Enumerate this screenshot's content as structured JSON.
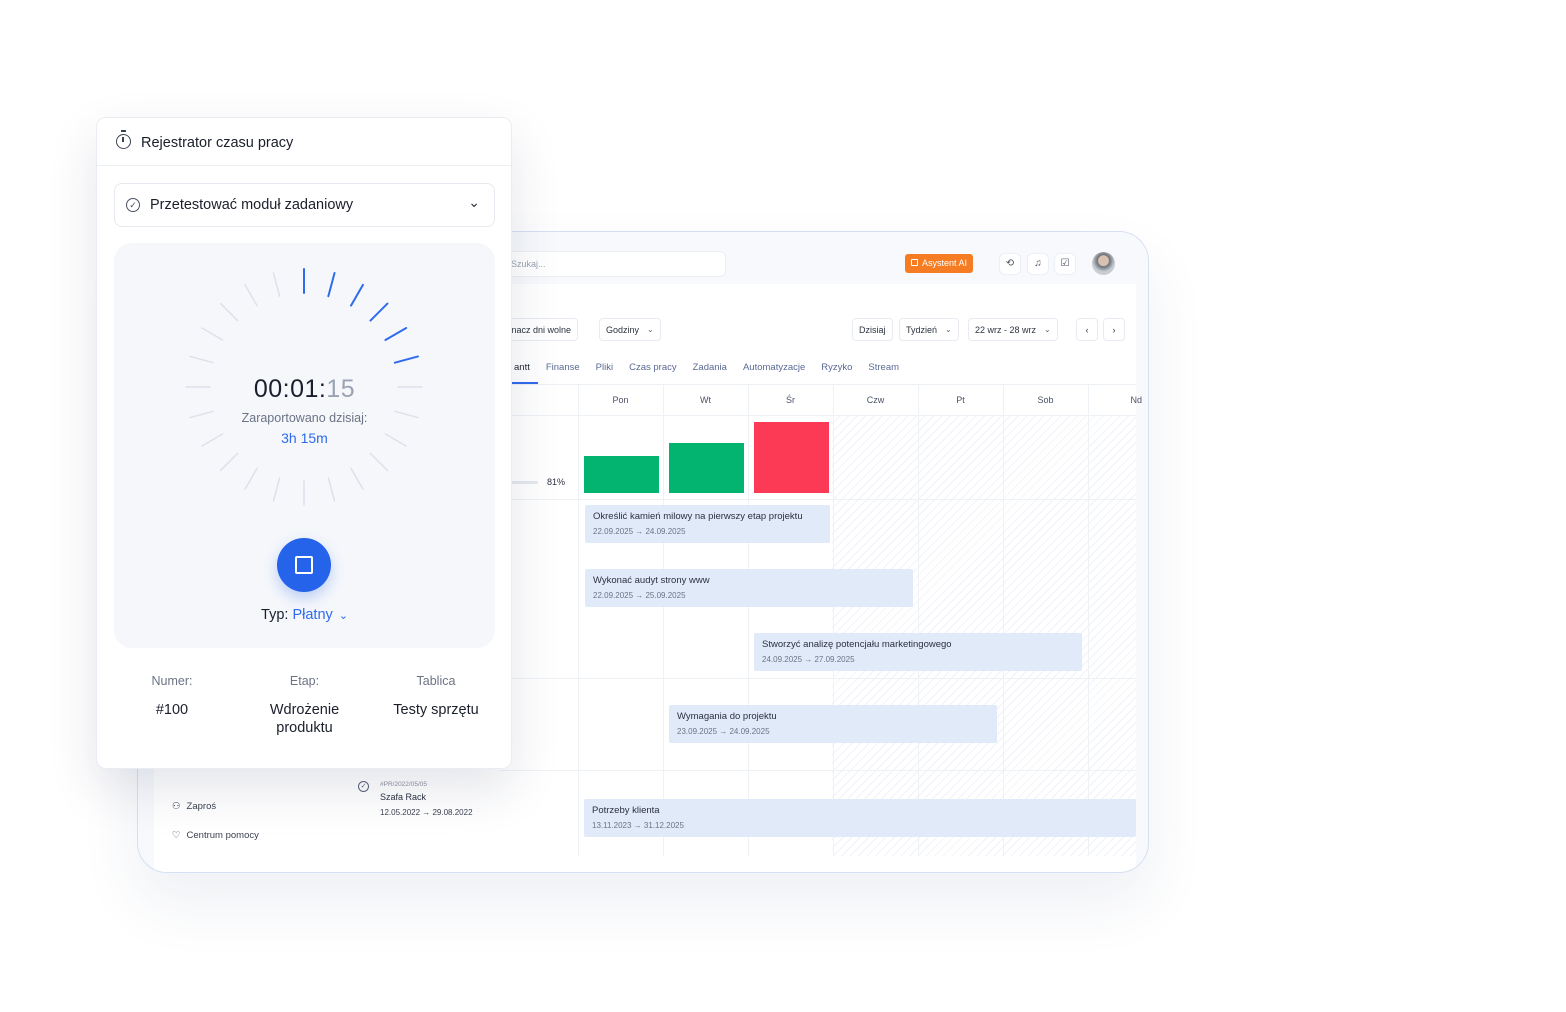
{
  "app": {
    "search_placeholder": "Szukaj...",
    "ai_button": "Asystent AI",
    "toolbar": {
      "days_off": "znacz dni wolne",
      "hours": "Godziny",
      "today": "Dzisiaj",
      "week": "Tydzień",
      "range": "22 wrz - 28 wrz"
    },
    "tabs": [
      "antt",
      "Finanse",
      "Pliki",
      "Czas pracy",
      "Zadania",
      "Automatyzacje",
      "Ryzyko",
      "Stream"
    ],
    "days": [
      "Pon",
      "Wt",
      "Śr",
      "Czw",
      "Pt",
      "Sob",
      "Nd"
    ],
    "workload_percent": "81%",
    "workload_bars": [
      {
        "day": "Pon",
        "level": 0.52,
        "status": "ok"
      },
      {
        "day": "Wt",
        "level": 0.7,
        "status": "ok"
      },
      {
        "day": "Śr",
        "level": 0.98,
        "status": "over"
      }
    ],
    "tasks": [
      {
        "name": "Określić kamień milowy na pierwszy etap projektu",
        "dates": "22.09.2025 → 24.09.2025"
      },
      {
        "name": "Wykonać audyt strony www",
        "dates": "22.09.2025 → 25.09.2025"
      },
      {
        "name": "Stworzyć analizę potencjału marketingowego",
        "dates": "24.09.2025 → 27.09.2025"
      },
      {
        "name": "Wymagania do projektu",
        "dates": "23.09.2025 → 24.09.2025"
      },
      {
        "name": "Potrzeby klienta",
        "dates": "13.11.2023 → 31.12.2025"
      }
    ],
    "sidebar": {
      "invite": "Zaproś",
      "help": "Centrum pomocy"
    },
    "project": {
      "code": "#PR/2022/05/05",
      "name": "Szafa Rack",
      "dates": "12.05.2022 → 29.08.2022"
    },
    "colors": {
      "ok": "#02b46f",
      "over": "#fd3a55",
      "accent": "#2f6bed",
      "ai": "#f57c22"
    }
  },
  "timer": {
    "title": "Rejestrator czasu pracy",
    "task": "Przetestować moduł zadaniowy",
    "time_main": "00:01:",
    "time_seconds": "15",
    "reported_label": "Zaraportowano dzisiaj:",
    "reported_value": "3h 15m",
    "type_label": "Typ:",
    "type_value": "Płatny",
    "progress_ticks_active": 6,
    "meta": [
      {
        "label": "Numer:",
        "value": "#100"
      },
      {
        "label": "Etap:",
        "value": "Wdrożenie produktu"
      },
      {
        "label": "Tablica",
        "value": "Testy sprzętu"
      }
    ]
  }
}
